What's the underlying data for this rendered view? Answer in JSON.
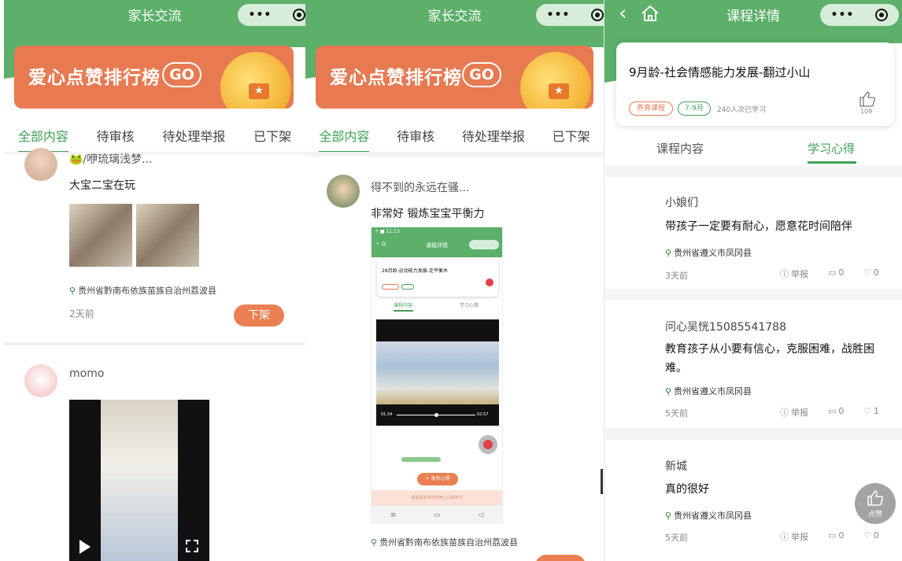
{
  "capsule": {
    "more": "•••"
  },
  "screen1": {
    "title": "家长交流",
    "banner": {
      "text": "爱心点赞排行榜",
      "go": "GO"
    },
    "tabs": [
      "全部内容",
      "待审核",
      "待处理举报",
      "已下架"
    ],
    "post1": {
      "username": "🐸/咿琉璃浅梦...",
      "text": "大宝二宝在玩",
      "location": "贵州省黔南布依族苗族自治州荔波县",
      "time": "2天前",
      "button": "下架"
    },
    "post2": {
      "username": "momo"
    }
  },
  "screen2": {
    "title": "家长交流",
    "banner": {
      "text": "爱心点赞排行榜",
      "go": "GO"
    },
    "tabs": [
      "全部内容",
      "待审核",
      "待处理举报",
      "已下架"
    ],
    "post": {
      "username": "得不到的永远在骚...",
      "text": "非常好 锻炼宝宝平衡力",
      "location": "贵州省黔南布依族苗族自治州荔波县"
    },
    "mini": {
      "status_time": "↰ ■ 11:13",
      "title": "课程详情",
      "course": "28月龄-运动能力发展-走平衡木",
      "tab_content": "课程内容",
      "tab_notes": "学习心得",
      "time_start": "01:34",
      "time_end": "02:57",
      "float_btn": "+ 发布心得",
      "bottom_text": "观看后发布你的育儿心得学习"
    }
  },
  "screen3": {
    "title": "课程详情",
    "course_title": "9月龄-社会情感能力发展-翻过小山",
    "chip1": "养育课程",
    "chip2": "7-9月",
    "learners": "240人次已学习",
    "likes": "109",
    "tabs": [
      "课程内容",
      "学习心得"
    ],
    "comments": [
      {
        "name": "小娘们",
        "text": "带孩子一定要有耐心，愿意花时间陪伴",
        "location": "贵州省遵义市凤冈县",
        "time": "3天前",
        "report": "举报",
        "comments": "0",
        "likes": "0"
      },
      {
        "name": "问心吴恍15085541788",
        "text": "教育孩子从小要有信心，克服困难，战胜困难。",
        "location": "贵州省遵义市凤冈县",
        "time": "5天前",
        "report": "举报",
        "comments": "0",
        "likes": "1"
      },
      {
        "name": "新城",
        "text": "真的很好",
        "location": "贵州省遵义市凤冈县",
        "time": "5天前",
        "report": "举报",
        "comments": "0",
        "likes": "0"
      }
    ],
    "fab_label": "点赞"
  }
}
